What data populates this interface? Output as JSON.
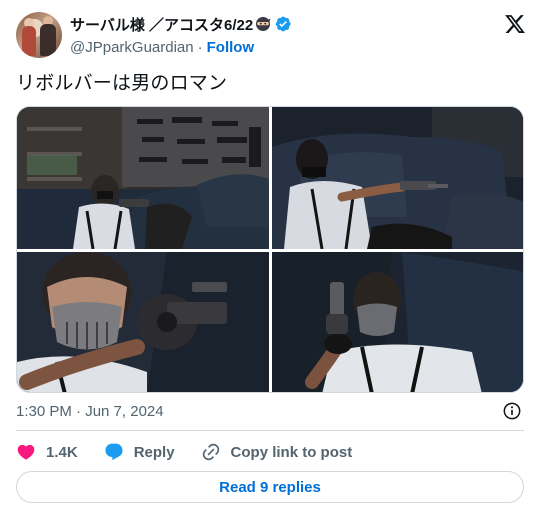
{
  "author": {
    "display_name": "サーバル様 ／アコスタ6/22",
    "handle": "@JPparkGuardian",
    "separator": "·",
    "follow_label": "Follow",
    "ninja_emoji": "ninja-icon",
    "verified": "verified-badge-icon"
  },
  "tweet": {
    "text": "リボルバーは男のロマン"
  },
  "media": {
    "images": [
      "photo-man-with-revolver-on-couch-gun-wall",
      "photo-man-reclining-on-couch-aiming-revolver",
      "photo-closeup-skull-mask-aiming-revolver",
      "photo-masked-man-holding-revolver-upright"
    ]
  },
  "meta": {
    "timestamp": "1:30 PM · Jun 7, 2024"
  },
  "actions": {
    "like_count": "1.4K",
    "reply_label": "Reply",
    "copy_label": "Copy link to post"
  },
  "footer": {
    "read_replies": "Read 9 replies"
  },
  "colors": {
    "accent": "#006fd6",
    "like": "#f91880",
    "verified": "#1d9bf0",
    "muted": "#536471",
    "border": "#cfd9de"
  }
}
